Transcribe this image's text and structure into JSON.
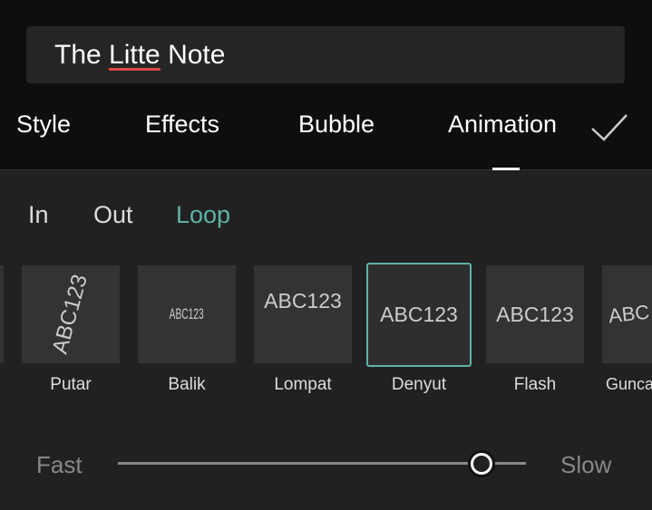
{
  "input": {
    "before": "The ",
    "misspelled": "Litte",
    "after": " Note"
  },
  "tabs": [
    {
      "label": "Style"
    },
    {
      "label": "Effects"
    },
    {
      "label": "Bubble"
    },
    {
      "label": "Animation",
      "active": true
    }
  ],
  "confirm_icon": "checkmark-icon",
  "subtabs": [
    {
      "label": "In"
    },
    {
      "label": "Out"
    },
    {
      "label": "Loop",
      "active": true
    }
  ],
  "accent": "#5fb3a6",
  "animations": [
    {
      "label": "Putar",
      "preview": "ABC123"
    },
    {
      "label": "Balik",
      "preview": "ABC123"
    },
    {
      "label": "Lompat",
      "preview": "ABC123"
    },
    {
      "label": "Denyut",
      "preview": "ABC123",
      "selected": true
    },
    {
      "label": "Flash",
      "preview": "ABC123"
    },
    {
      "label": "Gunca",
      "preview": "ABC"
    }
  ],
  "speed": {
    "min_label": "Fast",
    "max_label": "Slow",
    "value": 0.89
  }
}
